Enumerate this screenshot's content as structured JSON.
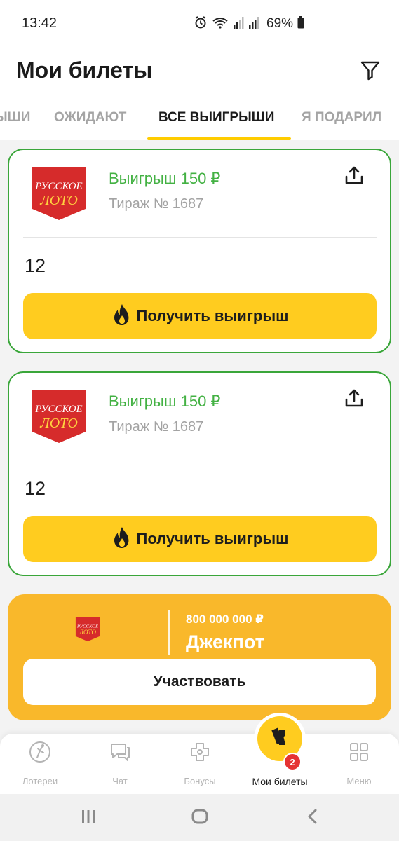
{
  "status_bar": {
    "time": "13:42",
    "battery": "69%"
  },
  "header": {
    "title": "Мои билеты",
    "filter_icon": "filter-icon"
  },
  "tabs": [
    {
      "label": "ЫШИ",
      "active": false
    },
    {
      "label": "ОЖИДАЮТ",
      "active": false
    },
    {
      "label": "ВСЕ ВЫИГРЫШИ",
      "active": true
    },
    {
      "label": "Я ПОДАРИЛ",
      "active": false
    }
  ],
  "tickets": [
    {
      "logo_text_top": "РУССКОЕ",
      "logo_text_bottom": "ЛОТО",
      "prize": "Выигрыш 150 ₽",
      "draw": "Тираж № 1687",
      "number": "12",
      "button_label": "Получить выигрыш"
    },
    {
      "logo_text_top": "РУССКОЕ",
      "logo_text_bottom": "ЛОТО",
      "prize": "Выигрыш 150 ₽",
      "draw": "Тираж № 1687",
      "number": "12",
      "button_label": "Получить выигрыш"
    }
  ],
  "jackpot": {
    "logo_text_top": "РУССКОЕ",
    "logo_text_bottom": "ЛОТО",
    "amount": "800 000 000 ₽",
    "label": "Джекпот",
    "button_label": "Участвовать"
  },
  "bottom_nav": {
    "items": [
      {
        "label": "Лотереи",
        "icon": "lottery-ball-icon",
        "active": false
      },
      {
        "label": "Чат",
        "icon": "chat-icon",
        "active": false
      },
      {
        "label": "Бонусы",
        "icon": "bonus-icon",
        "active": false
      },
      {
        "label": "Мои билеты",
        "icon": "tickets-icon",
        "active": true
      },
      {
        "label": "Меню",
        "icon": "menu-grid-icon",
        "active": false
      }
    ],
    "badge_count": "2"
  },
  "colors": {
    "accent_yellow": "#ffcc1f",
    "win_green": "#43b143",
    "card_border_green": "#3aa63a",
    "jackpot_orange": "#f9b82b",
    "logo_red": "#d62b2b"
  }
}
